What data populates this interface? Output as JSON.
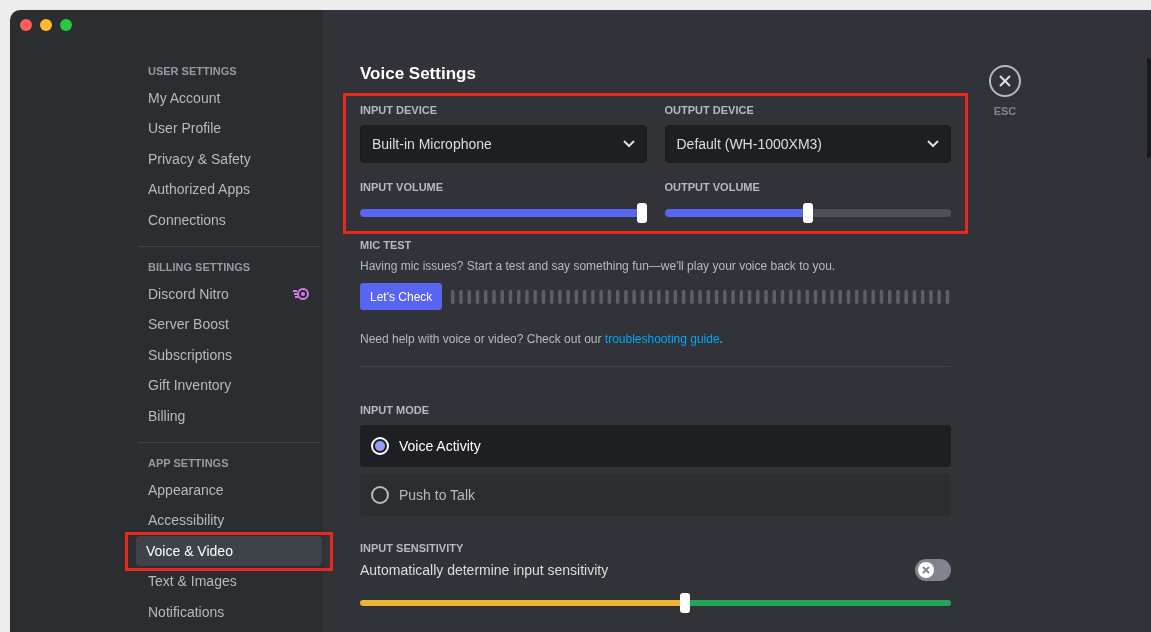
{
  "sidebar": {
    "sections": [
      {
        "header": "USER SETTINGS",
        "items": [
          {
            "label": "My Account",
            "selected": false
          },
          {
            "label": "User Profile",
            "selected": false
          },
          {
            "label": "Privacy & Safety",
            "selected": false
          },
          {
            "label": "Authorized Apps",
            "selected": false
          },
          {
            "label": "Connections",
            "selected": false
          }
        ]
      },
      {
        "header": "BILLING SETTINGS",
        "items": [
          {
            "label": "Discord Nitro",
            "selected": false,
            "badge": true
          },
          {
            "label": "Server Boost",
            "selected": false
          },
          {
            "label": "Subscriptions",
            "selected": false
          },
          {
            "label": "Gift Inventory",
            "selected": false
          },
          {
            "label": "Billing",
            "selected": false
          }
        ]
      },
      {
        "header": "APP SETTINGS",
        "items": [
          {
            "label": "Appearance",
            "selected": false
          },
          {
            "label": "Accessibility",
            "selected": false
          },
          {
            "label": "Voice & Video",
            "selected": true
          },
          {
            "label": "Text & Images",
            "selected": false
          },
          {
            "label": "Notifications",
            "selected": false
          }
        ]
      }
    ]
  },
  "title": "Voice Settings",
  "close": {
    "label": "ESC"
  },
  "devices": [
    {
      "label": "INPUT DEVICE",
      "value": "Built-in Microphone",
      "volume_label": "INPUT VOLUME",
      "level": 1.0
    },
    {
      "label": "OUTPUT DEVICE",
      "value": "Default (WH-1000XM3)",
      "volume_label": "OUTPUT VOLUME",
      "level": 0.5
    }
  ],
  "mic_test": {
    "header": "MIC TEST",
    "description": "Having mic issues? Start a test and say something fun—we'll play your voice back to you.",
    "button": "Let's Check"
  },
  "help": {
    "text": "Need help with voice or video? Check out our",
    "link": "troubleshooting guide",
    "end": "."
  },
  "input_mode": {
    "header": "INPUT MODE",
    "options": [
      {
        "label": "Voice Activity",
        "selected": true
      },
      {
        "label": "Push to Talk",
        "selected": false
      }
    ]
  },
  "sensitivity": {
    "header": "INPUT SENSITIVITY",
    "label": "Automatically determine input sensitivity",
    "on": false,
    "level": 0.55
  }
}
